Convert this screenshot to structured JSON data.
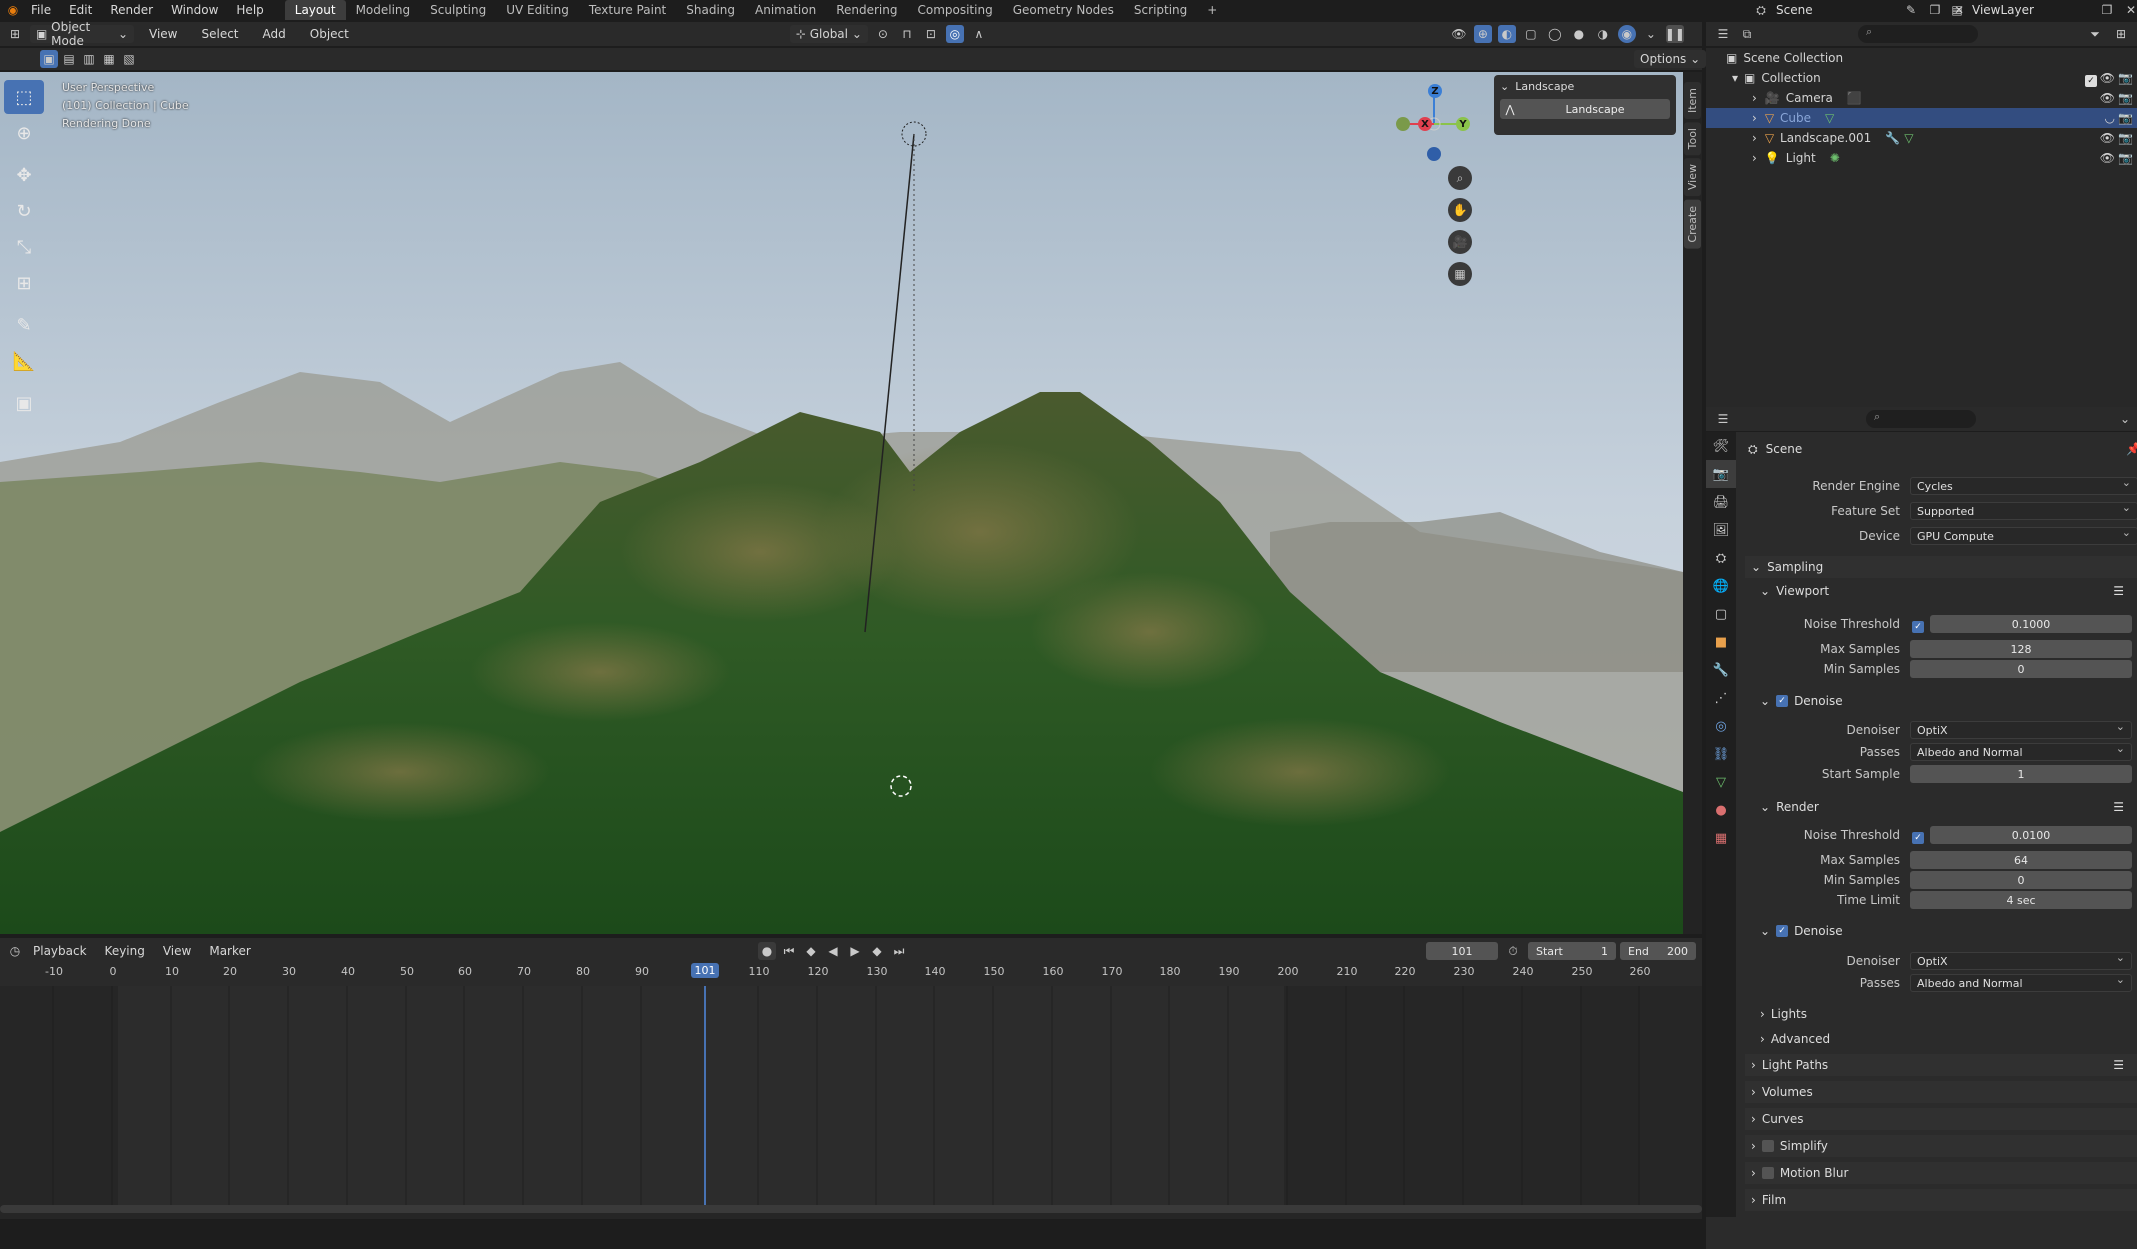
{
  "topbar": {
    "menus": [
      "File",
      "Edit",
      "Render",
      "Window",
      "Help"
    ],
    "workspaces": [
      "Layout",
      "Modeling",
      "Sculpting",
      "UV Editing",
      "Texture Paint",
      "Shading",
      "Animation",
      "Rendering",
      "Compositing",
      "Geometry Nodes",
      "Scripting"
    ],
    "active_workspace": "Layout",
    "add_tab": "+",
    "scene": "Scene",
    "view_layer": "ViewLayer"
  },
  "viewport_header": {
    "mode": "Object Mode",
    "menus": [
      "View",
      "Select",
      "Add",
      "Object"
    ],
    "orientation": "Global",
    "options": "Options"
  },
  "viewport": {
    "overlay_line1": "User Perspective",
    "overlay_line2": "(101) Collection | Cube",
    "overlay_line3": "Rendering Done",
    "gizmo": {
      "z": "Z",
      "x": "X",
      "y": "Y"
    },
    "npanel_title": "Landscape",
    "npanel_button": "Landscape",
    "side_tabs": [
      "Item",
      "Tool",
      "View",
      "Create"
    ]
  },
  "outliner": {
    "root": "Scene Collection",
    "collection": "Collection",
    "items": [
      {
        "name": "Camera",
        "icon": "camera-icon",
        "selected": false
      },
      {
        "name": "Cube",
        "icon": "cube-icon",
        "selected": true
      },
      {
        "name": "Landscape.001",
        "icon": "mesh-icon",
        "selected": false
      },
      {
        "name": "Light",
        "icon": "light-icon",
        "selected": false
      }
    ]
  },
  "properties": {
    "context": "Scene",
    "render_engine_label": "Render Engine",
    "render_engine": "Cycles",
    "feature_set_label": "Feature Set",
    "feature_set": "Supported",
    "device_label": "Device",
    "device": "GPU Compute",
    "sampling": "Sampling",
    "viewport": {
      "title": "Viewport",
      "noise_threshold_label": "Noise Threshold",
      "noise_threshold": "0.1000",
      "max_samples_label": "Max Samples",
      "max_samples": "128",
      "min_samples_label": "Min Samples",
      "min_samples": "0",
      "denoise": "Denoise",
      "denoiser_label": "Denoiser",
      "denoiser": "OptiX",
      "passes_label": "Passes",
      "passes": "Albedo and Normal",
      "start_sample_label": "Start Sample",
      "start_sample": "1"
    },
    "render": {
      "title": "Render",
      "noise_threshold_label": "Noise Threshold",
      "noise_threshold": "0.0100",
      "max_samples_label": "Max Samples",
      "max_samples": "64",
      "min_samples_label": "Min Samples",
      "min_samples": "0",
      "time_limit_label": "Time Limit",
      "time_limit": "4 sec",
      "denoise": "Denoise",
      "denoiser_label": "Denoiser",
      "denoiser": "OptiX",
      "passes_label": "Passes",
      "passes": "Albedo and Normal"
    },
    "subsections": [
      "Lights",
      "Advanced"
    ],
    "panels": [
      "Light Paths",
      "Volumes",
      "Curves",
      "Simplify",
      "Motion Blur",
      "Film"
    ]
  },
  "timeline": {
    "menus": [
      "Playback",
      "Keying",
      "View",
      "Marker"
    ],
    "current_frame": "101",
    "start_label": "Start",
    "start": "1",
    "end_label": "End",
    "end": "200",
    "ticks": [
      "-10",
      "0",
      "10",
      "20",
      "30",
      "40",
      "50",
      "60",
      "70",
      "80",
      "90",
      "101",
      "110",
      "120",
      "130",
      "140",
      "150",
      "160",
      "170",
      "180",
      "190",
      "200",
      "210",
      "220",
      "230",
      "240",
      "250",
      "260"
    ]
  },
  "colors": {
    "accent": "#4772b3",
    "selected_row": "#334d80",
    "x_axis": "#e0404f",
    "y_axis": "#8bc34a",
    "z_axis": "#3b7fd6"
  }
}
